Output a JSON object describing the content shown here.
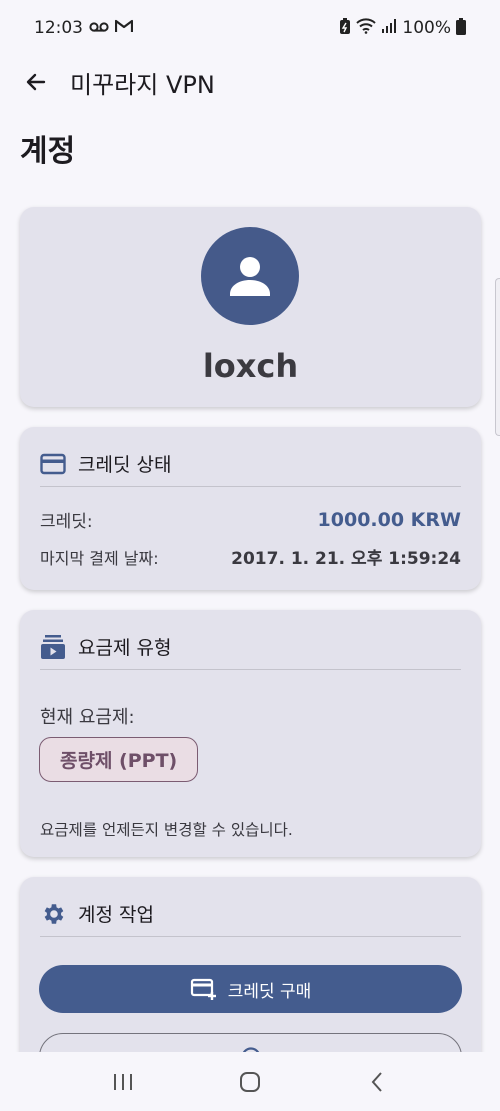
{
  "status_bar": {
    "time": "12:03",
    "battery": "100%",
    "icons": [
      "voicemail-icon",
      "gmail-icon",
      "battery-saver-icon",
      "wifi-icon",
      "signal-icon",
      "battery-icon"
    ]
  },
  "app_bar": {
    "title": "미꾸라지 VPN",
    "back_icon": "arrow-back-icon"
  },
  "page": {
    "title": "계정"
  },
  "profile": {
    "avatar_icon": "person-icon",
    "username": "loxch"
  },
  "credit": {
    "header": "크레딧 상태",
    "header_icon": "credit-card-icon",
    "credit_label": "크레딧:",
    "credit_value": "1000.00 KRW",
    "last_payment_label": "마지막 결제 날짜:",
    "last_payment_value": "2017. 1. 21. 오후 1:59:24"
  },
  "plan": {
    "header": "요금제 유형",
    "header_icon": "subscriptions-icon",
    "current_label": "현재 요금제:",
    "current_value": "종량제 (PPT)",
    "note": "요금제를 언제든지 변경할 수 있습니다."
  },
  "actions": {
    "header": "계정 작업",
    "header_icon": "gear-icon",
    "buy_credit_label": "크레딧 구매",
    "buy_credit_icon": "add-card-icon"
  },
  "nav": {
    "recents_icon": "recents-icon",
    "home_icon": "home-icon",
    "back_icon": "nav-back-icon"
  },
  "colors": {
    "accent": "#445c8e",
    "card": "#e3e2ec",
    "chip_border": "#7b5c72"
  }
}
